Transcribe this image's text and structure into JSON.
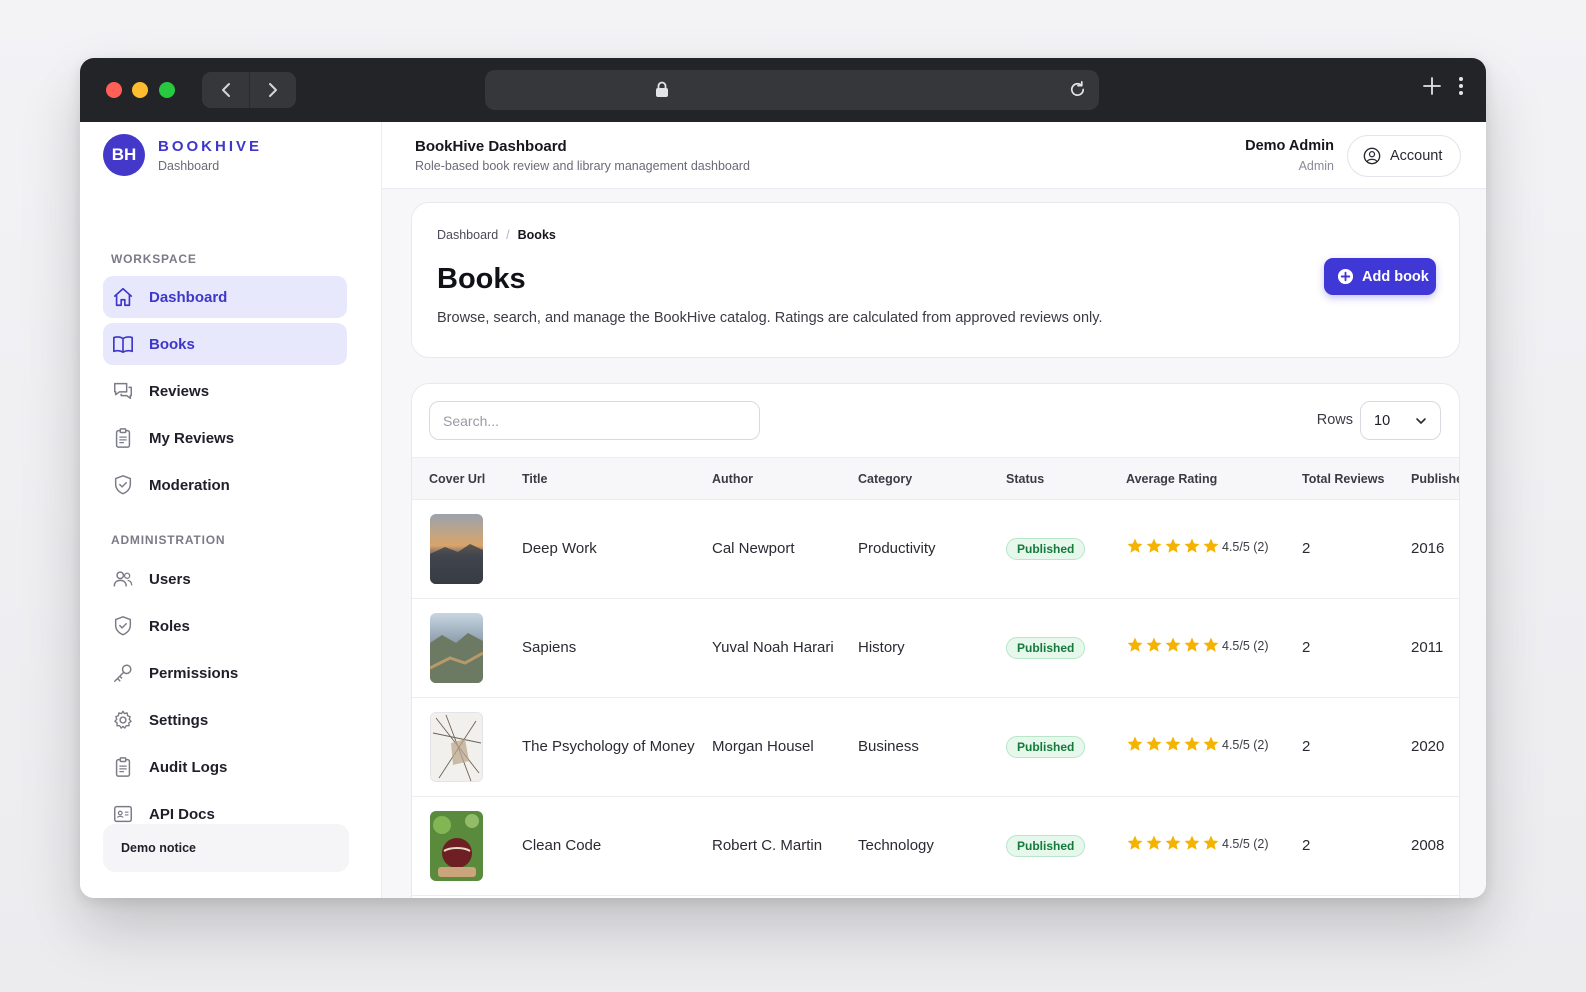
{
  "brand": {
    "logo": "BH",
    "name": "BOOKHIVE",
    "subtitle": "Dashboard"
  },
  "sidebar": {
    "workspace_label": "WORKSPACE",
    "workspace_items": [
      {
        "label": "Dashboard",
        "icon": "home-icon",
        "active": true
      },
      {
        "label": "Books",
        "icon": "book-icon",
        "active": true
      },
      {
        "label": "Reviews",
        "icon": "chat-icon",
        "active": false
      },
      {
        "label": "My Reviews",
        "icon": "clipboard-icon",
        "active": false
      },
      {
        "label": "Moderation",
        "icon": "shield-check-icon",
        "active": false
      }
    ],
    "admin_label": "ADMINISTRATION",
    "admin_items": [
      {
        "label": "Users",
        "icon": "users-icon"
      },
      {
        "label": "Roles",
        "icon": "shield-check-icon"
      },
      {
        "label": "Permissions",
        "icon": "key-icon"
      },
      {
        "label": "Settings",
        "icon": "gear-icon"
      },
      {
        "label": "Audit Logs",
        "icon": "clipboard-icon"
      },
      {
        "label": "API Docs",
        "icon": "id-card-icon"
      }
    ],
    "demo_notice": "Demo notice"
  },
  "topbar": {
    "title": "BookHive Dashboard",
    "subtitle": "Role-based book review and library management dashboard",
    "user_name": "Demo Admin",
    "user_role": "Admin",
    "account_label": "Account"
  },
  "page": {
    "breadcrumb": [
      "Dashboard",
      "Books"
    ],
    "title": "Books",
    "description": "Browse, search, and manage the BookHive catalog. Ratings are calculated from approved reviews only.",
    "add_button": "Add book"
  },
  "table": {
    "search_placeholder": "Search...",
    "rows_label": "Rows",
    "rows_value": "10",
    "columns": [
      "Cover Url",
      "Title",
      "Author",
      "Category",
      "Status",
      "Average Rating",
      "Total Reviews",
      "Published"
    ],
    "rows": [
      {
        "title": "Deep Work",
        "author": "Cal Newport",
        "category": "Productivity",
        "status": "Published",
        "stars": 5,
        "rating_text": "4.5/5 (2)",
        "total_reviews": "2",
        "published": "2016",
        "cover": "mountain-sunset"
      },
      {
        "title": "Sapiens",
        "author": "Yuval Noah Harari",
        "category": "History",
        "status": "Published",
        "stars": 5,
        "rating_text": "4.5/5 (2)",
        "total_reviews": "2",
        "published": "2011",
        "cover": "great-wall"
      },
      {
        "title": "The Psychology of Money",
        "author": "Morgan Housel",
        "category": "Business",
        "status": "Published",
        "stars": 5,
        "rating_text": "4.5/5 (2)",
        "total_reviews": "2",
        "published": "2020",
        "cover": "sketch"
      },
      {
        "title": "Clean Code",
        "author": "Robert C. Martin",
        "category": "Technology",
        "status": "Published",
        "stars": 5,
        "rating_text": "4.5/5 (2)",
        "total_reviews": "2",
        "published": "2008",
        "cover": "ball-on-grass"
      }
    ]
  },
  "colors": {
    "accent": "#3f37d6",
    "active_bg": "#e8e8fc",
    "badge_bg": "#e6f7ec",
    "badge_text": "#147a3a",
    "star": "#f5b301",
    "titlebar": "#232427"
  }
}
